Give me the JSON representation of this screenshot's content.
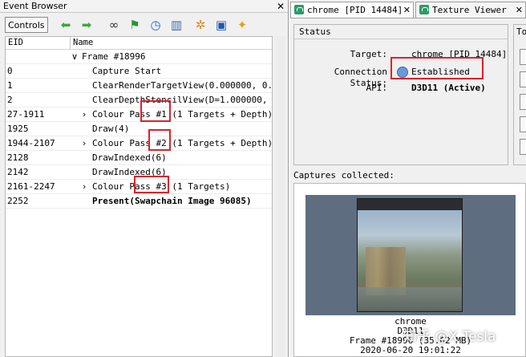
{
  "event_browser": {
    "title": "Event Browser",
    "close_label": "✕",
    "controls_label": "Controls",
    "toolbar_icons": [
      "arrow-left-icon",
      "arrow-right-icon",
      "binoculars-icon",
      "flag-icon",
      "clock-icon",
      "chart-icon",
      "gear-icon",
      "save-icon",
      "puzzle-icon"
    ],
    "columns": {
      "eid": "EID",
      "name": "Name"
    },
    "rows": [
      {
        "eid": "",
        "name": "Frame #18996",
        "expander": "∨"
      },
      {
        "eid": "0",
        "name": "Capture Start"
      },
      {
        "eid": "1",
        "name": "ClearRenderTargetView(0.000000, 0.…"
      },
      {
        "eid": "2",
        "name": "ClearDepthStencilView(D=1.000000, …"
      },
      {
        "eid": "27-1911",
        "name": "Colour Pass #1 (1 Targets + Depth)",
        "expander": "›"
      },
      {
        "eid": "1925",
        "name": "Draw(4)"
      },
      {
        "eid": "1944-2107",
        "name": "Colour Pass #2 (1 Targets + Depth)",
        "expander": "›"
      },
      {
        "eid": "2128",
        "name": "DrawIndexed(6)"
      },
      {
        "eid": "2142",
        "name": "DrawIndexed(6)"
      },
      {
        "eid": "2161-2247",
        "name": "Colour Pass #3 (1 Targets)",
        "expander": "›"
      },
      {
        "eid": "2252",
        "name": "Present(Swapchain Image 96085)"
      }
    ]
  },
  "tabs": [
    {
      "label": "chrome [PID 14484]",
      "close": "✕"
    },
    {
      "label": "Texture Viewer",
      "close": "✕"
    }
  ],
  "status": {
    "group_title": "Status",
    "target_label": "Target:",
    "target_value": "chrome [PID 14484]",
    "connection_label": "Connection Status:",
    "connection_value": "Established",
    "api_label": "API:",
    "api_value": "D3D11 (Active)"
  },
  "side_group_title": "To",
  "captures": {
    "label": "Captures collected:",
    "caption_lines": [
      "chrome",
      "D3D11",
      "Frame #18996 (35.02 MB)",
      "2020-06-20 19:01:22"
    ]
  },
  "watermark": "知乎 @X Tesla",
  "colors": {
    "highlight": "#e0202a",
    "accent_green": "#2e9a6a"
  }
}
